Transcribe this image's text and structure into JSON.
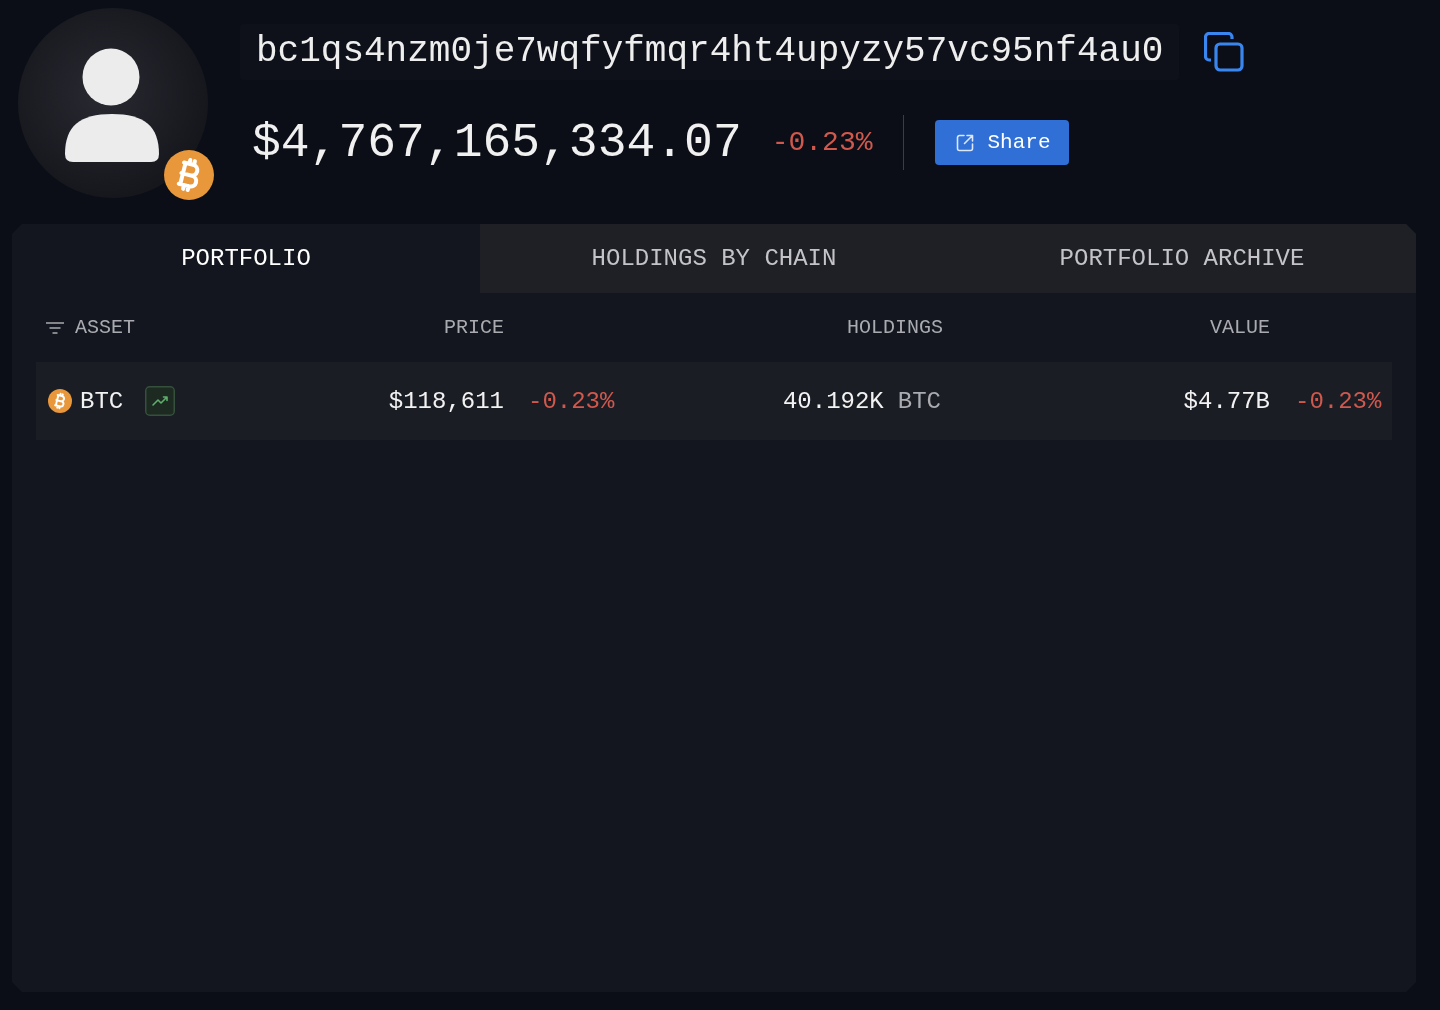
{
  "profile": {
    "address": "bc1qs4nzm0je7wqfyfmqr4ht4upyzy57vc95nf4au0",
    "total_value": "$4,767,165,334.07",
    "change": "-0.23%",
    "change_negative": true,
    "share_button": "Share"
  },
  "tabs": [
    {
      "label": "PORTFOLIO",
      "selected": true
    },
    {
      "label": "HOLDINGS BY CHAIN",
      "selected": false
    },
    {
      "label": "PORTFOLIO ARCHIVE",
      "selected": false
    }
  ],
  "table": {
    "columns": [
      "ASSET",
      "PRICE",
      "HOLDINGS",
      "VALUE"
    ],
    "rows": [
      {
        "asset": "BTC",
        "price": "$118,611",
        "price_change": "-0.23%",
        "price_change_negative": true,
        "holdings": "40.192K",
        "holdings_unit": "BTC",
        "value": "$4.77B",
        "value_change": "-0.23%",
        "value_change_negative": true
      }
    ]
  }
}
